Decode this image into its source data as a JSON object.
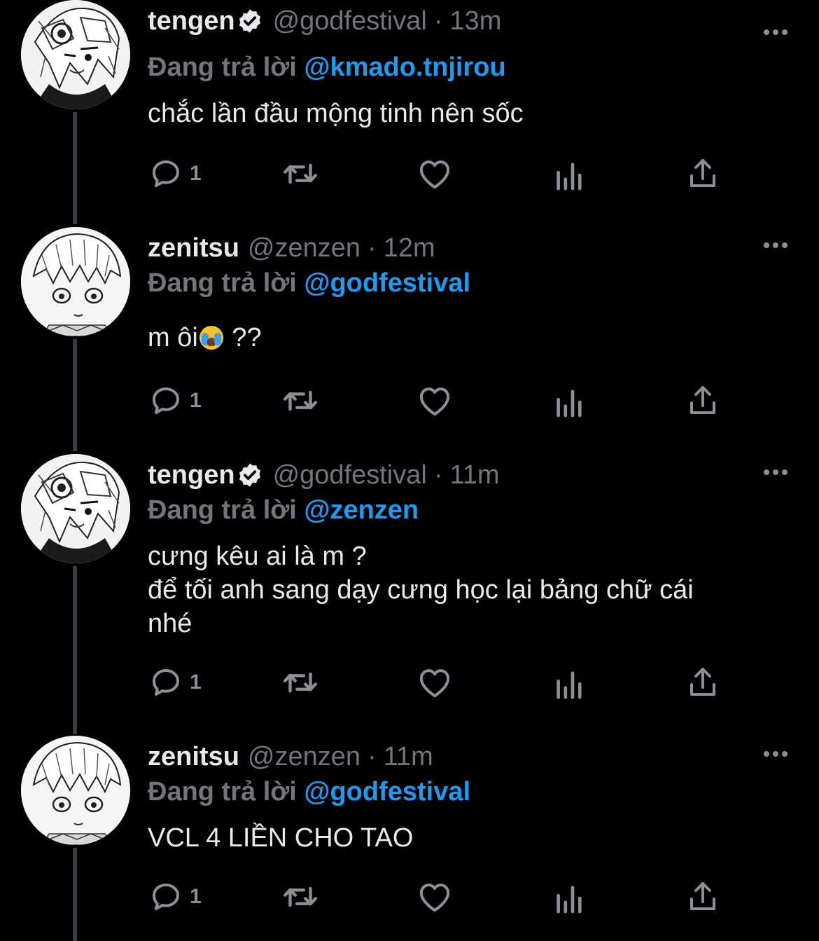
{
  "thread": {
    "tweets": [
      {
        "name": "tengen",
        "verified": true,
        "handle": "@godfestival",
        "separator": "·",
        "time": "13m",
        "reply_prefix": "Đang trả lời",
        "reply_mention": "@kmado.tnjirou",
        "text_lines": [
          "chắc lần đầu mộng tinh nên sốc"
        ],
        "reply_count": "1",
        "avatar": "tengen-avatar"
      },
      {
        "name": "zenitsu",
        "verified": false,
        "handle": "@zenzen",
        "separator": "·",
        "time": "12m",
        "reply_prefix": "Đang trả lời",
        "reply_mention": "@godfestival",
        "text_before_emoji": "m ôi",
        "emoji": "loudly-crying-face",
        "text_after_emoji": " ??",
        "reply_count": "1",
        "avatar": "zenitsu-avatar"
      },
      {
        "name": "tengen",
        "verified": true,
        "handle": "@godfestival",
        "separator": "·",
        "time": "11m",
        "reply_prefix": "Đang trả lời",
        "reply_mention": "@zenzen",
        "text_lines": [
          "cưng kêu ai là m ?",
          "để tối anh sang dạy cưng học lại bảng chữ cái",
          "nhé"
        ],
        "reply_count": "1",
        "avatar": "tengen-avatar"
      },
      {
        "name": "zenitsu",
        "verified": false,
        "handle": "@zenzen",
        "separator": "·",
        "time": "11m",
        "reply_prefix": "Đang trả lời",
        "reply_mention": "@godfestival",
        "text_lines": [
          "VCL 4 LIỀN CHO TAO"
        ],
        "reply_count": "1",
        "avatar": "zenitsu-avatar"
      }
    ]
  },
  "icons": {
    "reply": "comment-bubble-icon",
    "retweet": "retweet-icon",
    "like": "heart-icon",
    "analytics": "analytics-icon",
    "share": "share-icon",
    "more": "more-icon",
    "verified": "verified-badge-icon"
  },
  "colors": {
    "background": "#000000",
    "primary_text": "#e7e9ea",
    "secondary_text": "#71767b",
    "mention": "#1d9bf0",
    "thread_line": "#3a3d40"
  }
}
